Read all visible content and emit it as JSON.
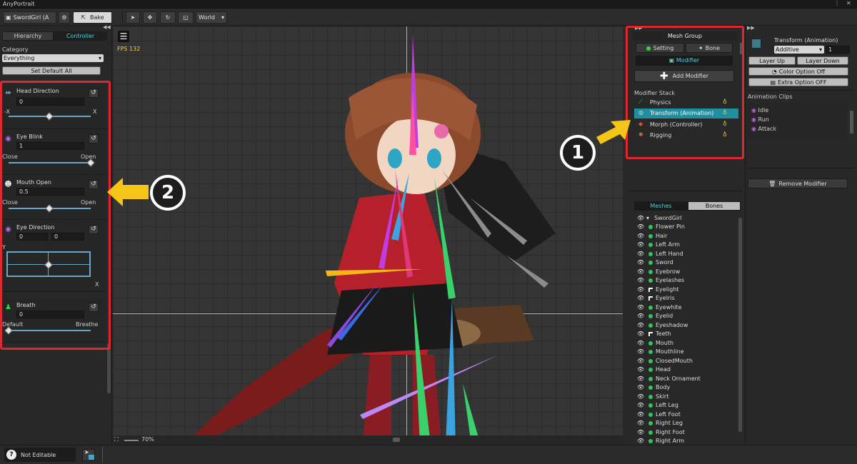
{
  "app": {
    "title": "AnyPortrait"
  },
  "toolbar": {
    "portrait_name": "SwordGirl (A",
    "bake_label": "Bake",
    "coord_space": "World"
  },
  "left": {
    "tabs": [
      "Hierarchy",
      "Controller"
    ],
    "category_label": "Category",
    "category_value": "Everything",
    "set_default_label": "Set Default All",
    "controls": [
      {
        "name": "Head Direction",
        "value": "0",
        "min": "-X",
        "max": "X"
      },
      {
        "name": "Eye Blink",
        "value": "1",
        "min": "Close",
        "max": "Open"
      },
      {
        "name": "Mouth Open",
        "value": "0.5",
        "min": "Close",
        "max": "Open"
      },
      {
        "name": "Eye Direction",
        "value_x": "0",
        "value_y": "0",
        "axis_y": "Y",
        "axis_x": "X"
      },
      {
        "name": "Breath",
        "value": "0",
        "min": "Default",
        "max": "Breathe"
      }
    ]
  },
  "viewport": {
    "fps": "FPS 132",
    "zoom": "70%"
  },
  "mid": {
    "header": "Mesh Group",
    "setting_label": "Setting",
    "bone_label": "Bone",
    "modifier_label": "Modifier",
    "add_modifier_label": "Add Modifier",
    "stack_label": "Modifier Stack",
    "stack": [
      "Physics",
      "Transform (Animation)",
      "Morph (Controller)",
      "Rigging"
    ],
    "tabs": [
      "Meshes",
      "Bones"
    ],
    "root": "SwordGirl",
    "meshes": [
      "Flower Pin",
      "Hair",
      "Left Arm",
      "Left Hand",
      "Sword",
      "Eyebrow",
      "Eyelashes",
      "Eyelight",
      "EyeIris",
      "Eyewhite",
      "Eyelid",
      "Eyeshadow",
      "Teeth",
      "Mouth",
      "Mouthline",
      "ClosedMouth",
      "Head",
      "Neck Ornament",
      "Body",
      "Skirt",
      "Left Leg",
      "Left Foot",
      "Right Leg",
      "Right Foot",
      "Right Arm"
    ]
  },
  "right": {
    "title": "Transform (Animation)",
    "blend_mode": "Additive",
    "weight": "1",
    "layer_up": "Layer Up",
    "layer_down": "Layer Down",
    "color_option": "Color Option Off",
    "extra_option": "Extra Option OFF",
    "clips_label": "Animation Clips",
    "clips": [
      "Idle",
      "Run",
      "Attack"
    ],
    "remove_label": "Remove Modifier"
  },
  "annotations": {
    "badge1": "1",
    "badge2": "2"
  },
  "status": {
    "editable": "Not Editable"
  },
  "colors": {
    "accent": "#4fd0d8",
    "highlight_red": "#e0262f",
    "arrow_yellow": "#f5c518",
    "selected_row": "#1f8fa0"
  }
}
